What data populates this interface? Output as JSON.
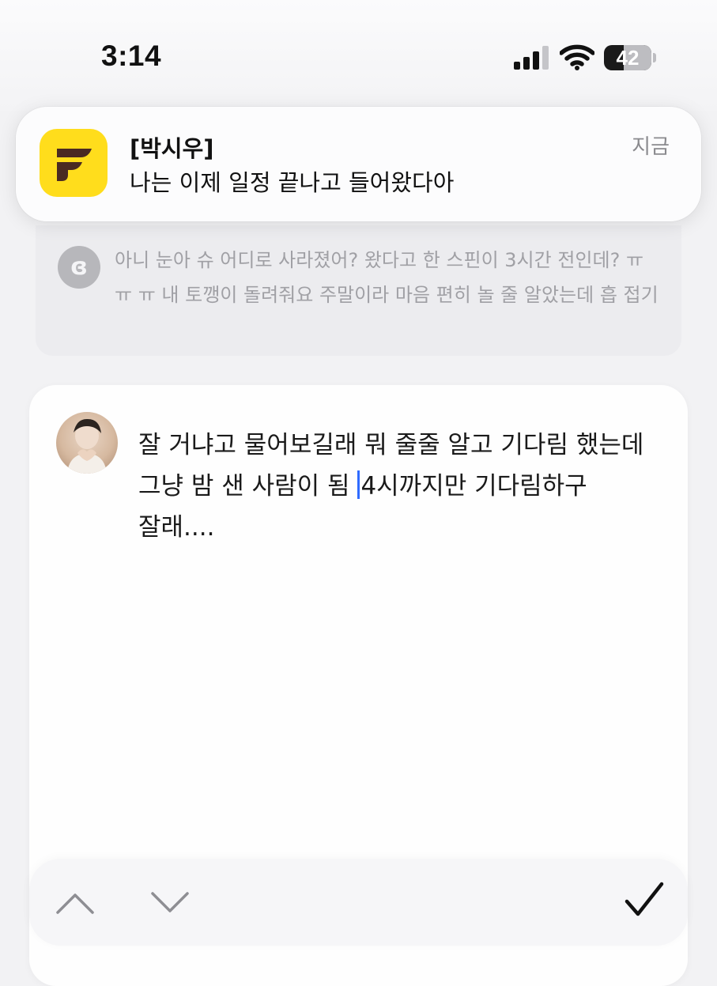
{
  "status_bar": {
    "time": "3:14",
    "battery_percent": "42",
    "battery_level": 0.42,
    "icons": [
      "signal-icon",
      "wifi-icon",
      "battery-icon"
    ]
  },
  "notification": {
    "app_icon": "app-logo-icon",
    "app_icon_color": "#ffdd1c",
    "sender": "[박시우]",
    "message": "나는 이제 일정 끝나고 들어왔다아",
    "time": "지금"
  },
  "previous_message": {
    "avatar_glyph": "ɞ",
    "text": "아니 눈아 슈 어디로 사라졌어? 왔다고 한 스핀이 3시간 전인데? ㅠ ㅠ ㅠ 내 토깽이 돌려줘요 주말이라 마음 편히 놀 줄 알았는데 흡 접기"
  },
  "compose": {
    "text_before_caret": "잘 거냐고 물어보길래 뭐 줄줄 알고 기다림 했는데 그냥 밤 샌 사람이 됨 ",
    "text_after_caret": "4시까지만 기다림하구 잘래....",
    "caret_color": "#2f6bff"
  },
  "toolbar": {
    "up_icon": "chevron-up-icon",
    "down_icon": "chevron-down-icon",
    "done_icon": "checkmark-icon"
  }
}
